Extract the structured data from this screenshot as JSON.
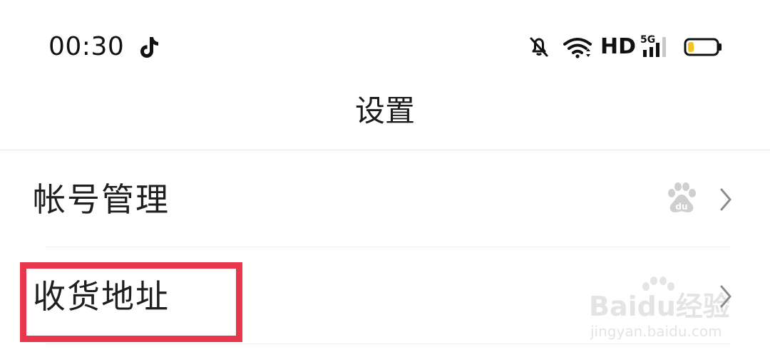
{
  "status_bar": {
    "time": "00:30",
    "hd": "HD",
    "network": "5G",
    "icons": [
      "tiktok-icon",
      "mute-bell-icon",
      "wifi-icon",
      "signal-icon",
      "battery-icon"
    ],
    "battery_level": 0.15
  },
  "nav": {
    "title": "设置"
  },
  "settings": {
    "items": [
      {
        "label": "帐号管理",
        "icon": "baidu-paw-icon",
        "trailing": "chevron-right-icon"
      },
      {
        "label": "收货地址",
        "trailing": "chevron-right-icon"
      }
    ]
  },
  "annotation": {
    "highlight_color": "#e8364c"
  },
  "watermark": {
    "brand": "Baidu经验",
    "url": "jingyan.baidu.com"
  }
}
